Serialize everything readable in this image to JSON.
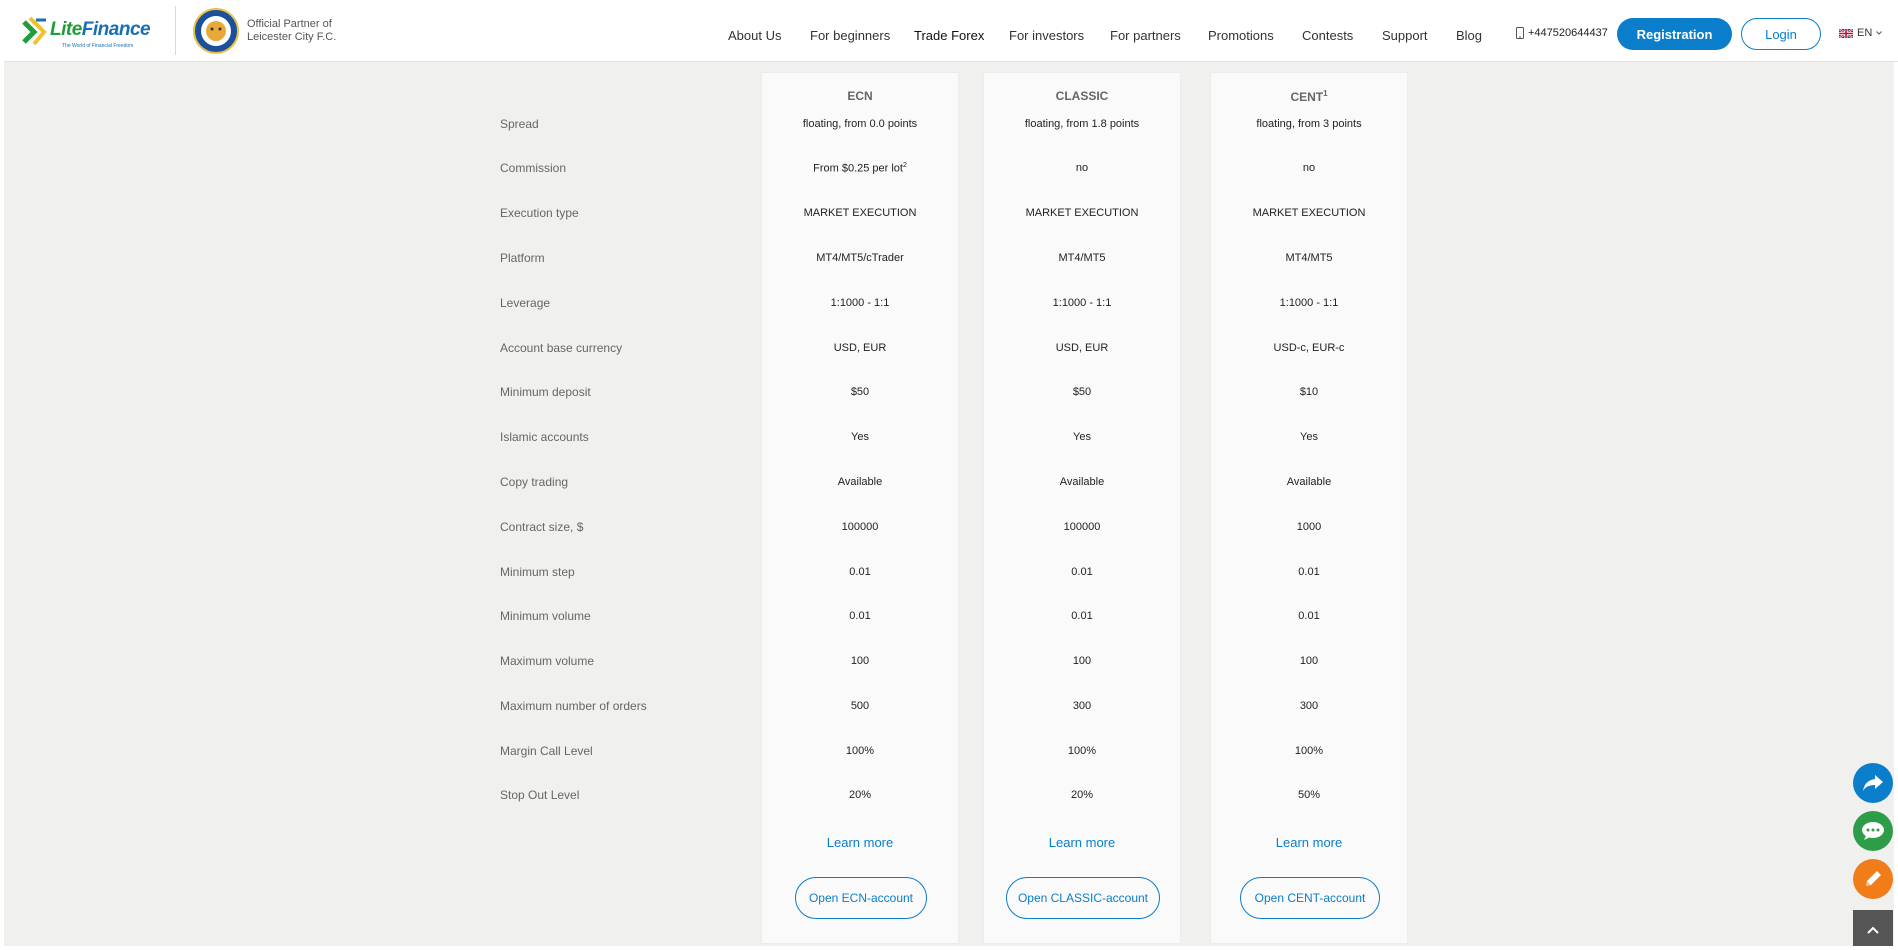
{
  "brand": {
    "logo_text_1": "Lite",
    "logo_text_2": "Finance",
    "tagline": "The World of Financial Freedom",
    "partner_line1": "Official Partner of",
    "partner_line2": "Leicester City F.C."
  },
  "nav": {
    "items": [
      "About Us",
      "For beginners",
      "Trade Forex",
      "For investors",
      "For partners",
      "Promotions",
      "Contests",
      "Support",
      "Blog"
    ],
    "active": "Trade Forex",
    "phone": "+447520644437",
    "registration": "Registration",
    "login": "Login",
    "language": "EN"
  },
  "table": {
    "row_labels": [
      "Spread",
      "Commission",
      "Execution type",
      "Platform",
      "Leverage",
      "Account base currency",
      "Minimum deposit",
      "Islamic accounts",
      "Copy trading",
      "Contract size, $",
      "Minimum step",
      "Minimum volume",
      "Maximum volume",
      "Maximum number of orders",
      "Margin Call Level",
      "Stop Out Level"
    ],
    "columns": [
      {
        "name": "ECN",
        "note": "",
        "values": [
          "floating, from 0.0 points",
          "From $0.25 per lot",
          "MARKET EXECUTION",
          "MT4/MT5/cTrader",
          "1:1000 - 1:1",
          "USD, EUR",
          "$50",
          "Yes",
          "Available",
          "100000",
          "0.01",
          "0.01",
          "100",
          "500",
          "100%",
          "20%"
        ],
        "commission_note": "2",
        "learn_more": "Learn more",
        "open_button": "Open ECN-account"
      },
      {
        "name": "CLASSIC",
        "note": "",
        "values": [
          "floating, from 1.8 points",
          "no",
          "MARKET EXECUTION",
          "MT4/MT5",
          "1:1000 - 1:1",
          "USD, EUR",
          "$50",
          "Yes",
          "Available",
          "100000",
          "0.01",
          "0.01",
          "100",
          "300",
          "100%",
          "20%"
        ],
        "commission_note": "",
        "learn_more": "Learn more",
        "open_button": "Open CLASSIC-account"
      },
      {
        "name": "CENT",
        "note": "1",
        "values": [
          "floating, from 3 points",
          "no",
          "MARKET EXECUTION",
          "MT4/MT5",
          "1:1000 - 1:1",
          "USD-c, EUR-c",
          "$10",
          "Yes",
          "Available",
          "1000",
          "0.01",
          "0.01",
          "100",
          "300",
          "100%",
          "50%"
        ],
        "commission_note": "",
        "learn_more": "Learn more",
        "open_button": "Open CENT-account"
      }
    ]
  },
  "colors": {
    "brand_blue": "#0a7ecb",
    "brand_green": "#1e9d3a",
    "share_fab": "#0a7ecb",
    "chat_fab": "#2e9d49",
    "edit_fab": "#f07d1a"
  },
  "icons": {
    "share": "share-icon",
    "chat": "chat-icon",
    "edit": "pencil-icon",
    "scroll_top": "chevron-up-icon",
    "phone": "phone-icon",
    "flag": "uk-flag-icon"
  }
}
